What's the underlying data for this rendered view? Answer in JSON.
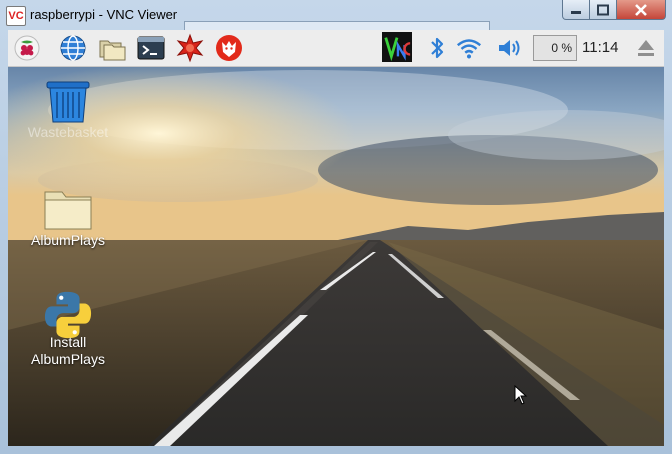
{
  "window": {
    "title": "raspberrypi - VNC Viewer",
    "app_icon_text": "VC"
  },
  "taskbar": {
    "apps": [
      "raspberry-menu",
      "web-browser",
      "file-manager",
      "terminal",
      "mathematica",
      "wolfram"
    ],
    "cpu_usage": "0 %",
    "clock": "11:14"
  },
  "desktop": {
    "icons": [
      {
        "label": "Wastebasket",
        "icon": "trash-icon"
      },
      {
        "label": "AlbumPlays",
        "icon": "folder-icon"
      },
      {
        "label_line1": "Install",
        "label_line2": "AlbumPlays",
        "icon": "python-icon"
      }
    ]
  },
  "colors": {
    "accent": "#2f7fd6",
    "taskbar_bg": "#ededed",
    "close_red": "#c4463a"
  }
}
